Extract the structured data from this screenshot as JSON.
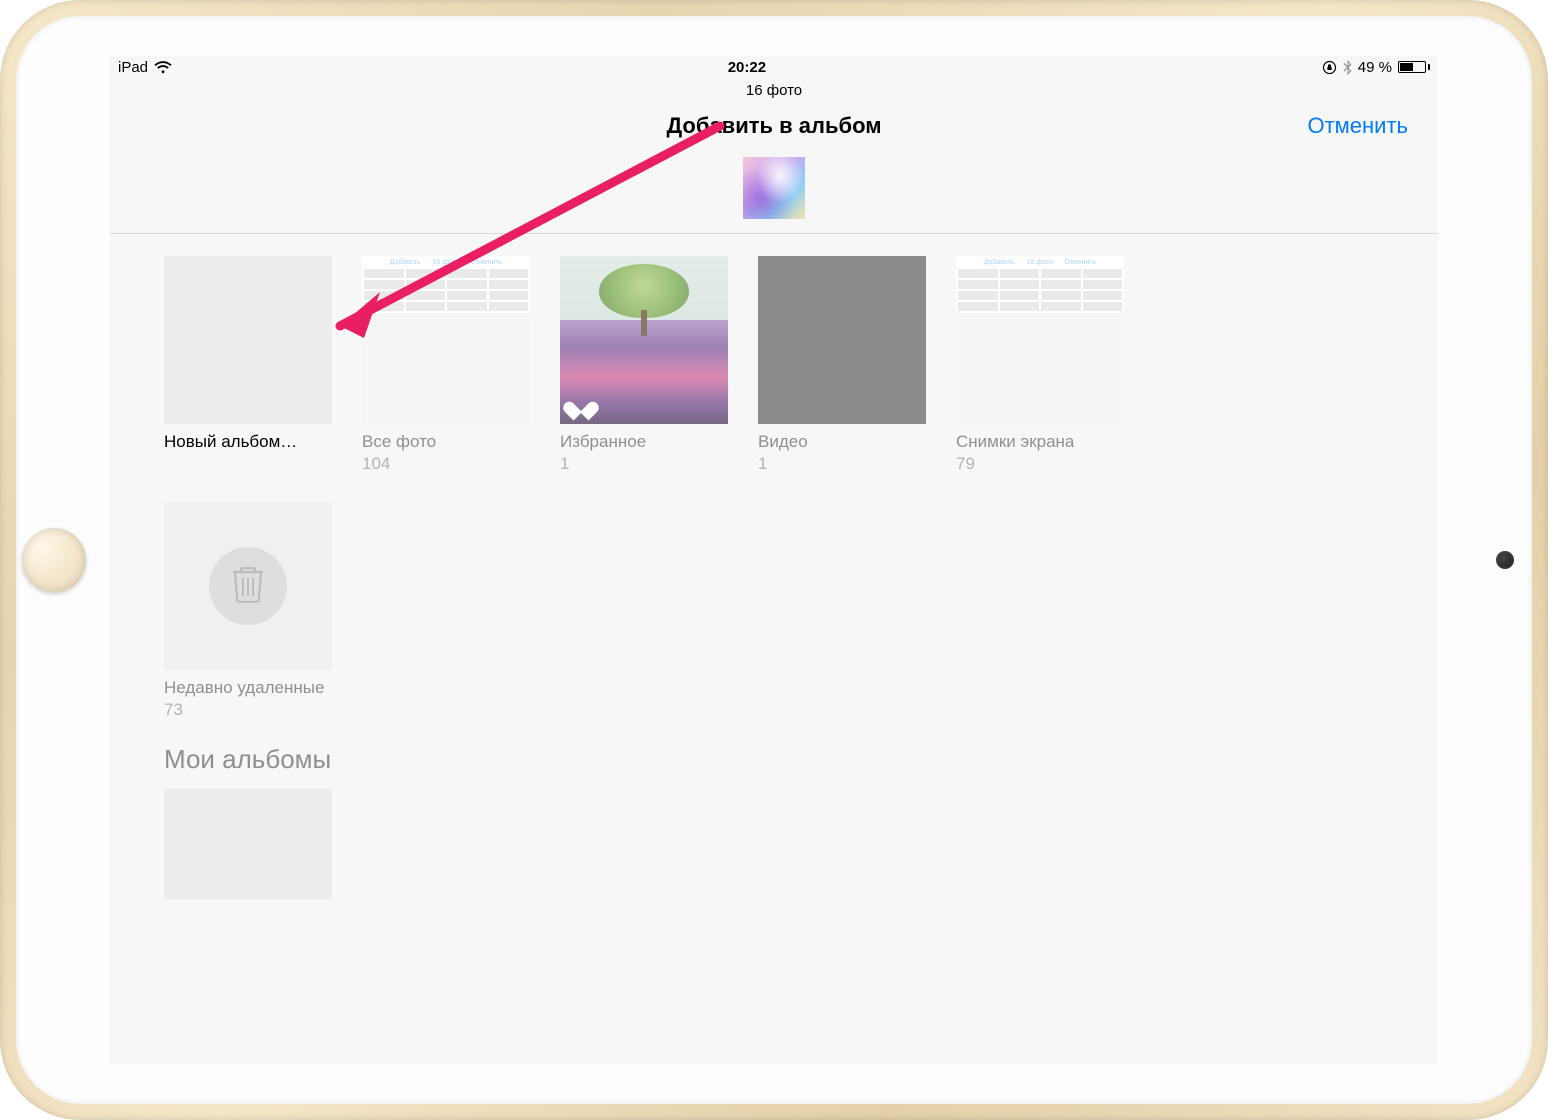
{
  "statusbar": {
    "device": "iPad",
    "time": "20:22",
    "battery_text": "49 %"
  },
  "header": {
    "count_text": "16 фото",
    "title": "Добавить в альбом",
    "cancel": "Отменить"
  },
  "albums": {
    "new_album": {
      "label": "Новый альбом…"
    },
    "all_photos": {
      "label": "Все фото",
      "count": "104"
    },
    "favorites": {
      "label": "Избранное",
      "count": "1"
    },
    "videos": {
      "label": "Видео",
      "count": "1"
    },
    "screenshots": {
      "label": "Снимки экрана",
      "count": "79"
    },
    "recently_deleted": {
      "label": "Недавно удаленные",
      "count": "73"
    }
  },
  "sections": {
    "my_albums": "Мои альбомы"
  }
}
